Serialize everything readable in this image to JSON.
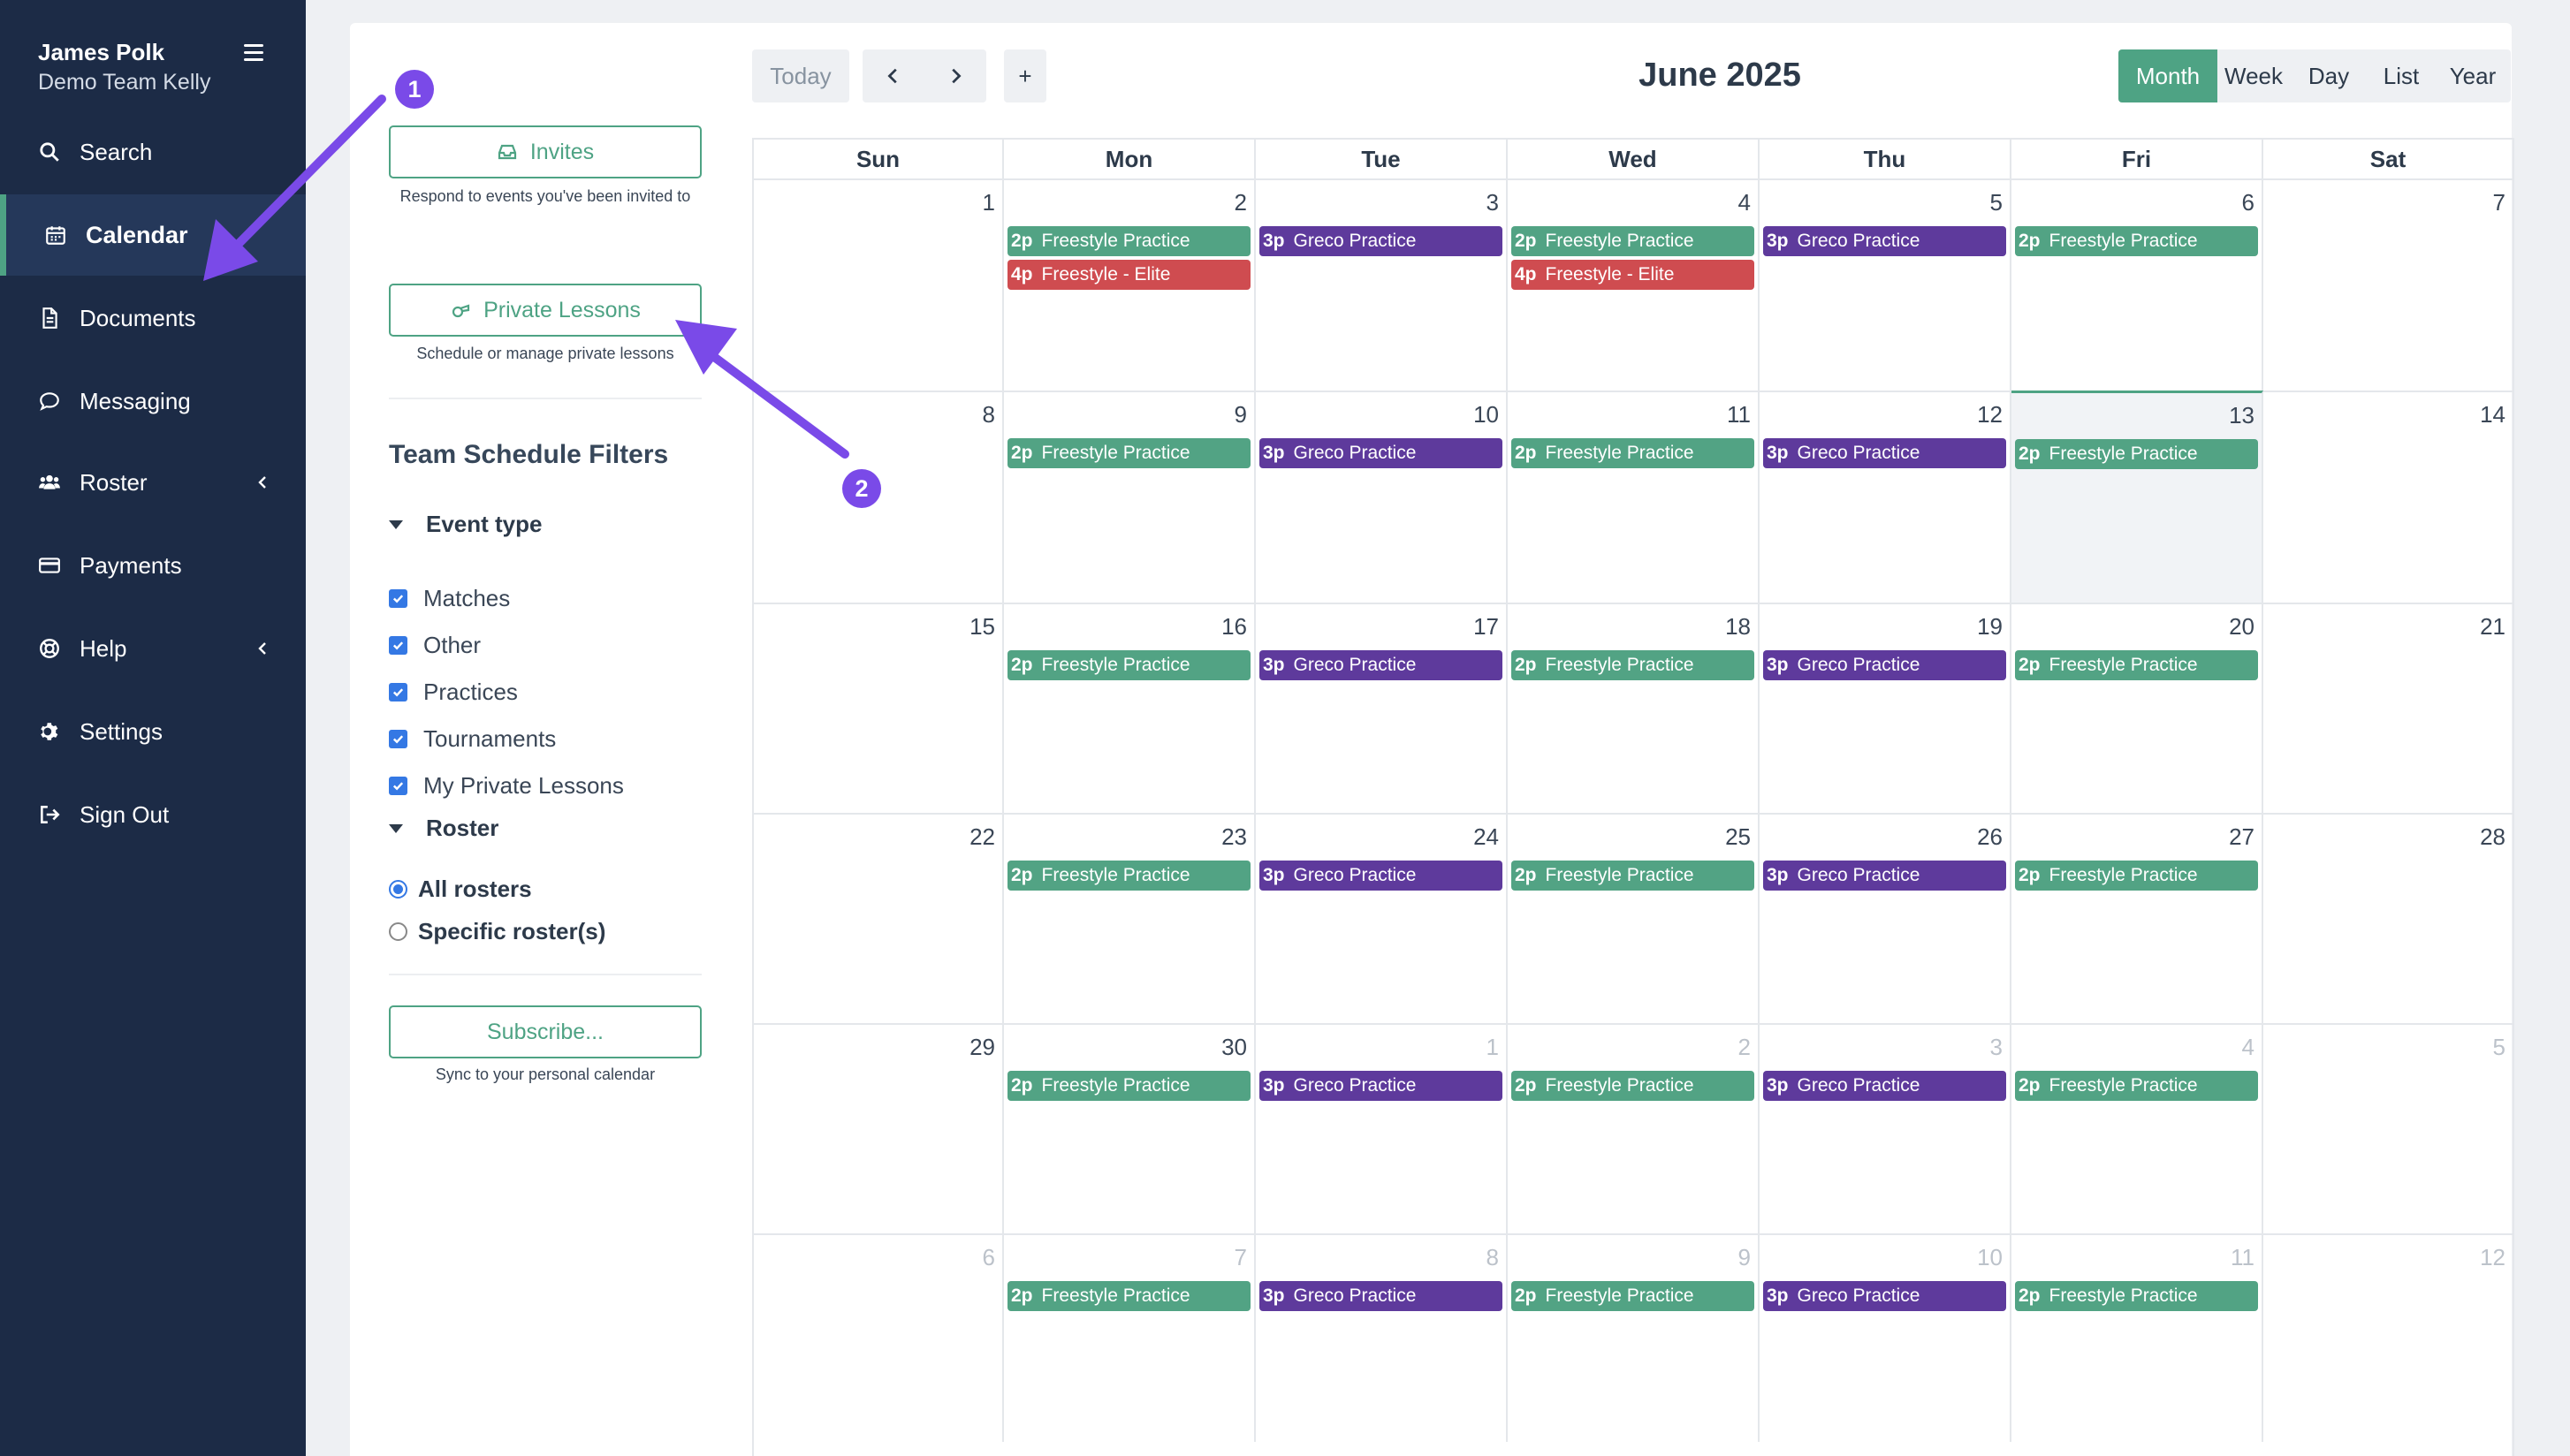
{
  "profile": {
    "name": "James Polk",
    "team": "Demo Team Kelly"
  },
  "nav": [
    {
      "label": "Search",
      "icon": "search-icon"
    },
    {
      "label": "Calendar",
      "icon": "calendar-icon",
      "active": true
    },
    {
      "label": "Documents",
      "icon": "document-icon"
    },
    {
      "label": "Messaging",
      "icon": "chat-icon"
    },
    {
      "label": "Roster",
      "icon": "users-icon",
      "has_chevron": true
    },
    {
      "label": "Payments",
      "icon": "credit-card-icon"
    },
    {
      "label": "Help",
      "icon": "lifebuoy-icon",
      "has_chevron": true
    },
    {
      "label": "Settings",
      "icon": "gear-icon"
    },
    {
      "label": "Sign Out",
      "icon": "sign-out-icon"
    }
  ],
  "panel": {
    "invites_label": "Invites",
    "invites_help": "Respond to events you've been invited to",
    "lessons_label": "Private Lessons",
    "lessons_help": "Schedule or manage private lessons",
    "filters_title": "Team Schedule Filters",
    "event_type_label": "Event type",
    "event_types": [
      "Matches",
      "Other",
      "Practices",
      "Tournaments",
      "My Private Lessons"
    ],
    "roster_label": "Roster",
    "roster_options": [
      {
        "label": "All rosters",
        "selected": true
      },
      {
        "label": "Specific roster(s)",
        "selected": false
      }
    ],
    "subscribe_label": "Subscribe...",
    "subscribe_help": "Sync to your personal calendar"
  },
  "toolbar": {
    "today_label": "Today",
    "add_label": "+",
    "title": "June 2025",
    "views": [
      "Month",
      "Week",
      "Day",
      "List",
      "Year"
    ],
    "active_view": "Month"
  },
  "calendar": {
    "days_of_week": [
      "Sun",
      "Mon",
      "Tue",
      "Wed",
      "Thu",
      "Fri",
      "Sat"
    ],
    "today": 13,
    "weeks": [
      [
        {
          "d": "1"
        },
        {
          "d": "2",
          "ev": [
            [
              "2p",
              "Freestyle Practice",
              "g"
            ],
            [
              "4p",
              "Freestyle - Elite",
              "r"
            ]
          ]
        },
        {
          "d": "3",
          "ev": [
            [
              "3p",
              "Greco Practice",
              "p"
            ]
          ]
        },
        {
          "d": "4",
          "ev": [
            [
              "2p",
              "Freestyle Practice",
              "g"
            ],
            [
              "4p",
              "Freestyle - Elite",
              "r"
            ]
          ]
        },
        {
          "d": "5",
          "ev": [
            [
              "3p",
              "Greco Practice",
              "p"
            ]
          ]
        },
        {
          "d": "6",
          "ev": [
            [
              "2p",
              "Freestyle Practice",
              "g"
            ]
          ]
        },
        {
          "d": "7"
        }
      ],
      [
        {
          "d": "8"
        },
        {
          "d": "9",
          "ev": [
            [
              "2p",
              "Freestyle Practice",
              "g"
            ]
          ]
        },
        {
          "d": "10",
          "ev": [
            [
              "3p",
              "Greco Practice",
              "p"
            ]
          ]
        },
        {
          "d": "11",
          "ev": [
            [
              "2p",
              "Freestyle Practice",
              "g"
            ]
          ]
        },
        {
          "d": "12",
          "ev": [
            [
              "3p",
              "Greco Practice",
              "p"
            ]
          ]
        },
        {
          "d": "13",
          "today": true,
          "ev": [
            [
              "2p",
              "Freestyle Practice",
              "g"
            ]
          ]
        },
        {
          "d": "14"
        }
      ],
      [
        {
          "d": "15"
        },
        {
          "d": "16",
          "ev": [
            [
              "2p",
              "Freestyle Practice",
              "g"
            ]
          ]
        },
        {
          "d": "17",
          "ev": [
            [
              "3p",
              "Greco Practice",
              "p"
            ]
          ]
        },
        {
          "d": "18",
          "ev": [
            [
              "2p",
              "Freestyle Practice",
              "g"
            ]
          ]
        },
        {
          "d": "19",
          "ev": [
            [
              "3p",
              "Greco Practice",
              "p"
            ]
          ]
        },
        {
          "d": "20",
          "ev": [
            [
              "2p",
              "Freestyle Practice",
              "g"
            ]
          ]
        },
        {
          "d": "21"
        }
      ],
      [
        {
          "d": "22"
        },
        {
          "d": "23",
          "ev": [
            [
              "2p",
              "Freestyle Practice",
              "g"
            ]
          ]
        },
        {
          "d": "24",
          "ev": [
            [
              "3p",
              "Greco Practice",
              "p"
            ]
          ]
        },
        {
          "d": "25",
          "ev": [
            [
              "2p",
              "Freestyle Practice",
              "g"
            ]
          ]
        },
        {
          "d": "26",
          "ev": [
            [
              "3p",
              "Greco Practice",
              "p"
            ]
          ]
        },
        {
          "d": "27",
          "ev": [
            [
              "2p",
              "Freestyle Practice",
              "g"
            ]
          ]
        },
        {
          "d": "28"
        }
      ],
      [
        {
          "d": "29"
        },
        {
          "d": "30",
          "ev": [
            [
              "2p",
              "Freestyle Practice",
              "g"
            ]
          ]
        },
        {
          "d": "1",
          "other": true,
          "ev": [
            [
              "3p",
              "Greco Practice",
              "p"
            ]
          ]
        },
        {
          "d": "2",
          "other": true,
          "ev": [
            [
              "2p",
              "Freestyle Practice",
              "g"
            ]
          ]
        },
        {
          "d": "3",
          "other": true,
          "ev": [
            [
              "3p",
              "Greco Practice",
              "p"
            ]
          ]
        },
        {
          "d": "4",
          "other": true,
          "ev": [
            [
              "2p",
              "Freestyle Practice",
              "g"
            ]
          ]
        },
        {
          "d": "5",
          "other": true
        }
      ],
      [
        {
          "d": "6",
          "other": true
        },
        {
          "d": "7",
          "other": true,
          "ev": [
            [
              "2p",
              "Freestyle Practice",
              "g"
            ]
          ]
        },
        {
          "d": "8",
          "other": true,
          "ev": [
            [
              "3p",
              "Greco Practice",
              "p"
            ]
          ]
        },
        {
          "d": "9",
          "other": true,
          "ev": [
            [
              "2p",
              "Freestyle Practice",
              "g"
            ]
          ]
        },
        {
          "d": "10",
          "other": true,
          "ev": [
            [
              "3p",
              "Greco Practice",
              "p"
            ]
          ]
        },
        {
          "d": "11",
          "other": true,
          "ev": [
            [
              "2p",
              "Freestyle Practice",
              "g"
            ]
          ]
        },
        {
          "d": "12",
          "other": true
        }
      ]
    ]
  },
  "annotations": [
    {
      "label": "1"
    },
    {
      "label": "2"
    }
  ],
  "colors": {
    "sidebar": "#1c2b46",
    "accent": "#4ea384",
    "freestyle": "#52a384",
    "greco": "#5e3a9c",
    "elite": "#cf4c50",
    "annotation": "#7a4ae8",
    "checkbox": "#3478e4"
  }
}
